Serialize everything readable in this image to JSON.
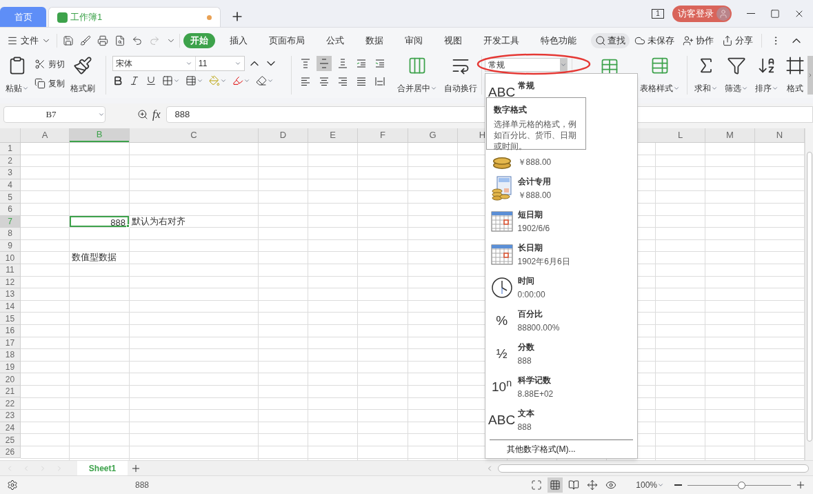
{
  "tabs": [
    {
      "label": "首页",
      "kind": "home",
      "selected": false
    },
    {
      "label": "工作簿1",
      "kind": "workbook",
      "selected": true,
      "modified": true
    }
  ],
  "account": {
    "window_count": "1",
    "login": "访客登录"
  },
  "menu": {
    "file": "文件",
    "ribbon_tabs": [
      {
        "label": "开始",
        "selected": true
      },
      {
        "label": "插入",
        "selected": false
      },
      {
        "label": "页面布局",
        "selected": false
      },
      {
        "label": "公式",
        "selected": false
      },
      {
        "label": "数据",
        "selected": false
      },
      {
        "label": "审阅",
        "selected": false
      },
      {
        "label": "视图",
        "selected": false
      },
      {
        "label": "开发工具",
        "selected": false
      },
      {
        "label": "特色功能",
        "selected": false
      }
    ],
    "search": "查找",
    "actions": [
      {
        "kind": "cloud",
        "label": "未保存"
      },
      {
        "kind": "collab",
        "label": "协作"
      },
      {
        "kind": "share",
        "label": "分享"
      }
    ]
  },
  "ribbon": {
    "paste": "粘贴",
    "cut": "剪切",
    "copy": "复制",
    "painter": "格式刷",
    "font_name": "宋体",
    "font_size": "11",
    "align_buttons": [
      {
        "kind": "top",
        "selected": false
      },
      {
        "kind": "middle",
        "selected": true
      },
      {
        "kind": "bottom",
        "selected": false
      },
      {
        "kind": "outdent",
        "selected": false
      },
      {
        "kind": "indent",
        "selected": false
      },
      {
        "kind": "left",
        "selected": false
      },
      {
        "kind": "center",
        "selected": false
      },
      {
        "kind": "right",
        "selected": false
      },
      {
        "kind": "justify",
        "selected": false
      },
      {
        "kind": "distributed",
        "selected": false
      }
    ],
    "merge": "合并居中",
    "wrap": "自动换行",
    "table_style": "表格样式",
    "tools": [
      {
        "kind": "sum",
        "label": "求和",
        "menu": true
      },
      {
        "kind": "filter",
        "label": "筛选",
        "menu": true
      },
      {
        "kind": "sort",
        "label": "排序",
        "menu": true
      },
      {
        "kind": "format",
        "label": "格式",
        "menu": false
      }
    ]
  },
  "number_format": {
    "value": "常规",
    "highlighted": true,
    "options": [
      {
        "kind": "glyph",
        "glyph": "ABC",
        "label": "常规"
      },
      {
        "kind": "coins",
        "sample": "￥888.00"
      },
      {
        "kind": "accounting",
        "label": "会计专用",
        "sample": "￥888.00"
      },
      {
        "kind": "calendar",
        "label": "短日期",
        "sample": "1902/6/6"
      },
      {
        "kind": "calendar",
        "label": "长日期",
        "sample": "1902年6月6日"
      },
      {
        "kind": "clock",
        "label": "时间",
        "sample": "0:00:00"
      },
      {
        "kind": "glyph",
        "glyph": "%",
        "label": "百分比",
        "sample": "88800.00%"
      },
      {
        "kind": "glyph",
        "glyph": "½",
        "label": "分数",
        "sample": "888"
      },
      {
        "kind": "glyph",
        "glyph": "10$^{n}$",
        "label": "科学记数",
        "sample": "8.88E+02"
      },
      {
        "kind": "glyph",
        "glyph": "ABC",
        "label": "文本",
        "sample": "888"
      }
    ],
    "more": "其他数字格式(M)...",
    "tooltip": {
      "title": "数字格式",
      "text": "选择单元格的格式，例如百分比、货币、日期或时间。"
    }
  },
  "formula_bar": {
    "cell_ref": "B7",
    "fx": "fx",
    "value": "888"
  },
  "sheet": {
    "columns": [
      {
        "label": "A",
        "selected": false
      },
      {
        "label": "B",
        "selected": true
      },
      {
        "label": "C",
        "selected": false
      },
      {
        "label": "D",
        "selected": false
      },
      {
        "label": "E",
        "selected": false
      },
      {
        "label": "F",
        "selected": false
      },
      {
        "label": "G",
        "selected": false
      },
      {
        "label": "H",
        "selected": false
      },
      {
        "label": "L",
        "selected": false
      },
      {
        "label": "M",
        "selected": false
      },
      {
        "label": "N",
        "selected": false
      }
    ],
    "rows": [
      {
        "label": "1",
        "selected": false
      },
      {
        "label": "2",
        "selected": false
      },
      {
        "label": "3",
        "selected": false
      },
      {
        "label": "4",
        "selected": false
      },
      {
        "label": "5",
        "selected": false
      },
      {
        "label": "6",
        "selected": false
      },
      {
        "label": "7",
        "selected": true,
        "cells": [
          {},
          {
            "kind": "number",
            "text": "888",
            "selected": true
          },
          {
            "kind": "text",
            "text": "默认为右对齐",
            "selected": false
          }
        ]
      },
      {
        "label": "8",
        "selected": false
      },
      {
        "label": "9",
        "selected": false
      },
      {
        "label": "10",
        "selected": false,
        "cells": [
          {},
          {
            "kind": "text",
            "text": "数值型数据",
            "selected": false
          }
        ]
      },
      {
        "label": "11",
        "selected": false
      },
      {
        "label": "12",
        "selected": false
      },
      {
        "label": "13",
        "selected": false
      },
      {
        "label": "14",
        "selected": false
      },
      {
        "label": "15",
        "selected": false
      },
      {
        "label": "16",
        "selected": false
      },
      {
        "label": "17",
        "selected": false
      },
      {
        "label": "18",
        "selected": false
      },
      {
        "label": "19",
        "selected": false
      },
      {
        "label": "20",
        "selected": false
      },
      {
        "label": "21",
        "selected": false
      },
      {
        "label": "22",
        "selected": false
      },
      {
        "label": "23",
        "selected": false
      },
      {
        "label": "24",
        "selected": false
      },
      {
        "label": "25",
        "selected": false
      },
      {
        "label": "26",
        "selected": false
      }
    ]
  },
  "sheet_tabs": [
    {
      "label": "Sheet1",
      "selected": true
    }
  ],
  "status": {
    "value": "888",
    "zoom": "100%",
    "zoom_slider": {
      "level": 0.52
    },
    "views": [
      {
        "kind": "normal",
        "selected": true
      },
      {
        "kind": "page",
        "selected": false
      },
      {
        "kind": "layout",
        "selected": false
      },
      {
        "kind": "eye",
        "selected": false
      }
    ]
  }
}
